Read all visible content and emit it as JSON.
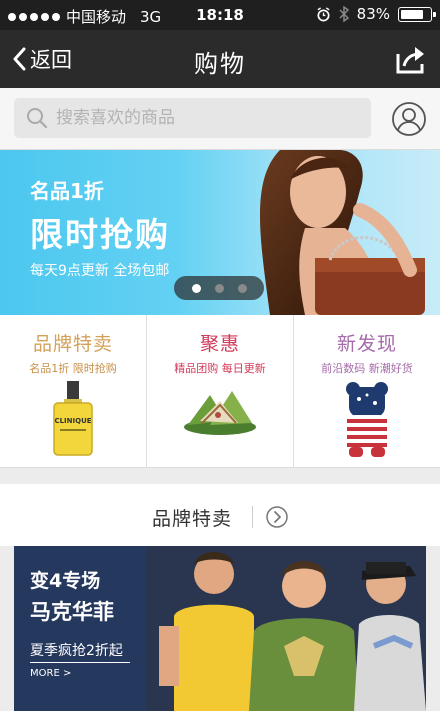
{
  "status_bar": {
    "carrier": "中国移动",
    "network": "3G",
    "time": "18:18",
    "battery": "83%",
    "battery_level": 0.83
  },
  "nav": {
    "back_label": "返回",
    "title": "购物",
    "share_icon": "share-icon"
  },
  "search": {
    "placeholder": "搜索喜欢的商品",
    "value": ""
  },
  "banner": {
    "line1": "名品1折",
    "line2": "限时抢购",
    "line3": "每天9点更新  全场包邮",
    "page_count": 3,
    "active_page": 1
  },
  "categories": [
    {
      "title": "品牌特卖",
      "subtitle": "名品1折 限时抢购",
      "color": "#d4a15a"
    },
    {
      "title": "聚惠",
      "subtitle": "精品团购 每日更新",
      "color": "#d23b5a"
    },
    {
      "title": "新发现",
      "subtitle": "前沿数码 新潮好货",
      "color": "#a56aa9"
    }
  ],
  "section": {
    "title": "品牌特卖"
  },
  "promo": {
    "line1": "变4专场",
    "line2": "马克华菲",
    "line3": "夏季疯抢2折起",
    "more": "MORE >"
  },
  "product_labels": {
    "clinique": "CLINIQUE"
  },
  "colors": {
    "nav_bg": "#2b2b2b",
    "banner_bg": "#4cc7ef",
    "promo_bg": "#25385e"
  }
}
